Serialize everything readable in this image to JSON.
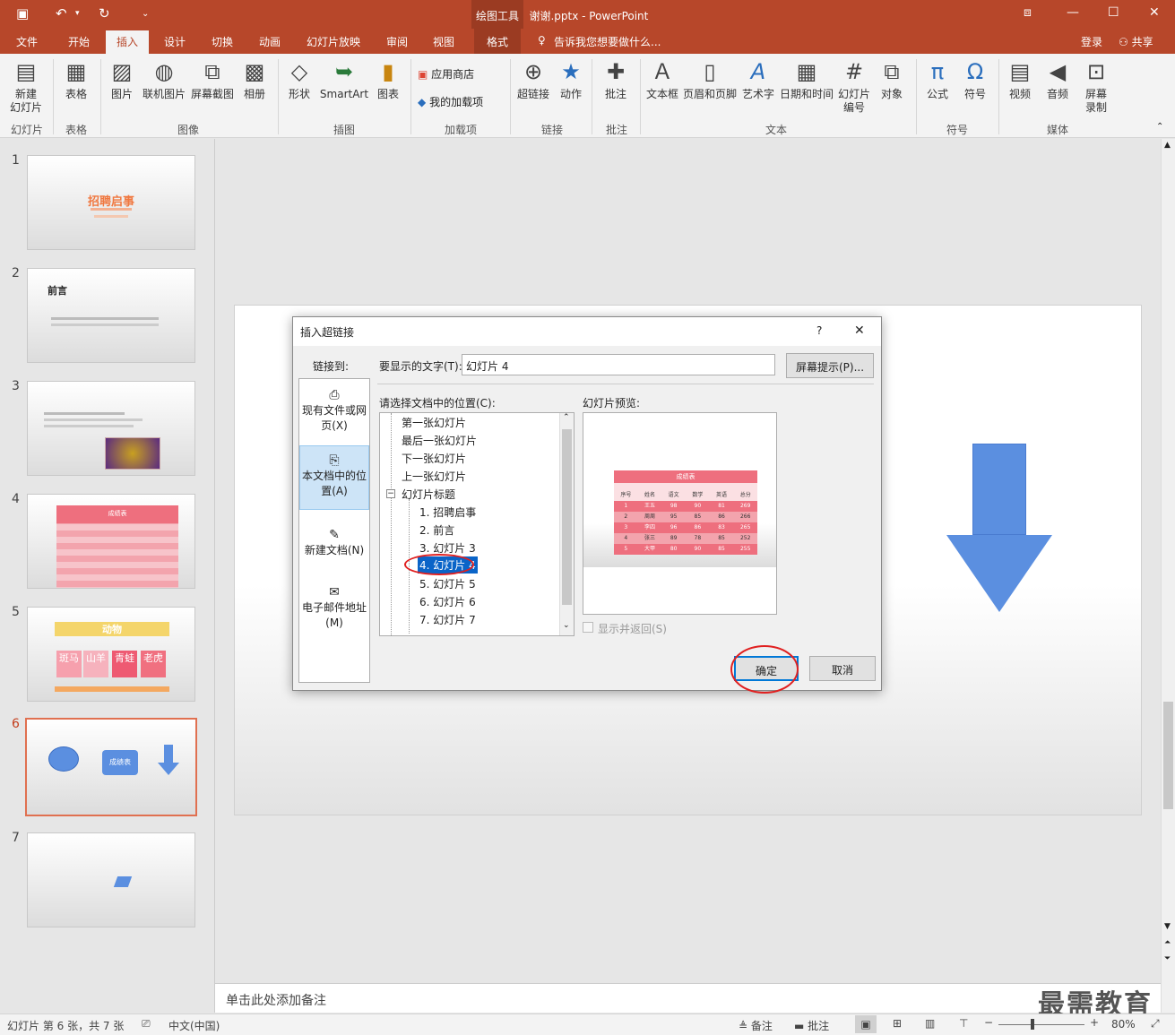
{
  "window": {
    "context_tools": "绘图工具",
    "title": "谢谢.pptx - PowerPoint"
  },
  "tabs": [
    "文件",
    "开始",
    "插入",
    "设计",
    "切换",
    "动画",
    "幻灯片放映",
    "审阅",
    "视图",
    "格式"
  ],
  "tell_me": "告诉我您想要做什么...",
  "account": {
    "login": "登录",
    "share": "共享"
  },
  "ribbon": {
    "buttons": [
      "新建\n幻灯片",
      "表格",
      "图片",
      "联机图片",
      "屏幕截图",
      "相册",
      "形状",
      "SmartArt",
      "图表",
      "应用商店",
      "我的加载项",
      "超链接",
      "动作",
      "批注",
      "文本框",
      "页眉和页脚",
      "艺术字",
      "日期和时间",
      "幻灯片\n编号",
      "对象",
      "公式",
      "符号",
      "视频",
      "音频",
      "屏幕\n录制"
    ],
    "groups": [
      "幻灯片",
      "表格",
      "图像",
      "插图",
      "加载项",
      "链接",
      "批注",
      "文本",
      "符号",
      "媒体"
    ]
  },
  "slides": {
    "numbers": [
      "1",
      "2",
      "3",
      "4",
      "5",
      "6",
      "7"
    ],
    "s1_title": "招聘启事",
    "s2_title": "前言",
    "s4_title": "成绩表",
    "s5_title": "动物",
    "s5_cells": [
      "斑马",
      "山羊",
      "青蛙",
      "老虎"
    ],
    "s6_label": "成绩表"
  },
  "table": {
    "headers": [
      "序号",
      "姓名",
      "语文",
      "数学",
      "英语",
      "总分"
    ],
    "rows": [
      [
        "1",
        "王五",
        "98",
        "90",
        "81",
        "269"
      ],
      [
        "2",
        "周周",
        "95",
        "85",
        "86",
        "266"
      ],
      [
        "3",
        "李四",
        "96",
        "86",
        "83",
        "265"
      ],
      [
        "4",
        "张三",
        "89",
        "78",
        "85",
        "252"
      ],
      [
        "5",
        "大甲",
        "80",
        "90",
        "85",
        "255"
      ]
    ]
  },
  "dialog": {
    "title": "插入超链接",
    "help": "?",
    "close": "✕",
    "link_to": "链接到:",
    "display_text_label": "要显示的文字(T):",
    "display_text_value": "幻灯片 4",
    "screen_tip": "屏幕提示(P)...",
    "select_place": "请选择文档中的位置(C):",
    "preview_label": "幻灯片预览:",
    "side_items": [
      "现有文件或网页(X)",
      "本文档中的位置(A)",
      "新建文档(N)",
      "电子邮件地址(M)"
    ],
    "tree": [
      "第一张幻灯片",
      "最后一张幻灯片",
      "下一张幻灯片",
      "上一张幻灯片",
      "幻灯片标题",
      "1. 招聘启事",
      "2. 前言",
      "3. 幻灯片 3",
      "4. 幻灯片 4",
      "5. 幻灯片 5",
      "6. 幻灯片 6",
      "7. 幻灯片 7"
    ],
    "show_return": "显示并返回(S)",
    "ok": "确定",
    "cancel": "取消"
  },
  "notes_placeholder": "单击此处添加备注",
  "status": {
    "slide_info": "幻灯片 第 6 张，共 7 张",
    "language": "中文(中国)",
    "notes": "备注",
    "comments": "批注",
    "zoom": "80%"
  },
  "watermark": "最需教育",
  "colors": {
    "accent": "#b7472a",
    "shape_blue": "#5b8fe0",
    "highlight": "#0a64c8"
  }
}
